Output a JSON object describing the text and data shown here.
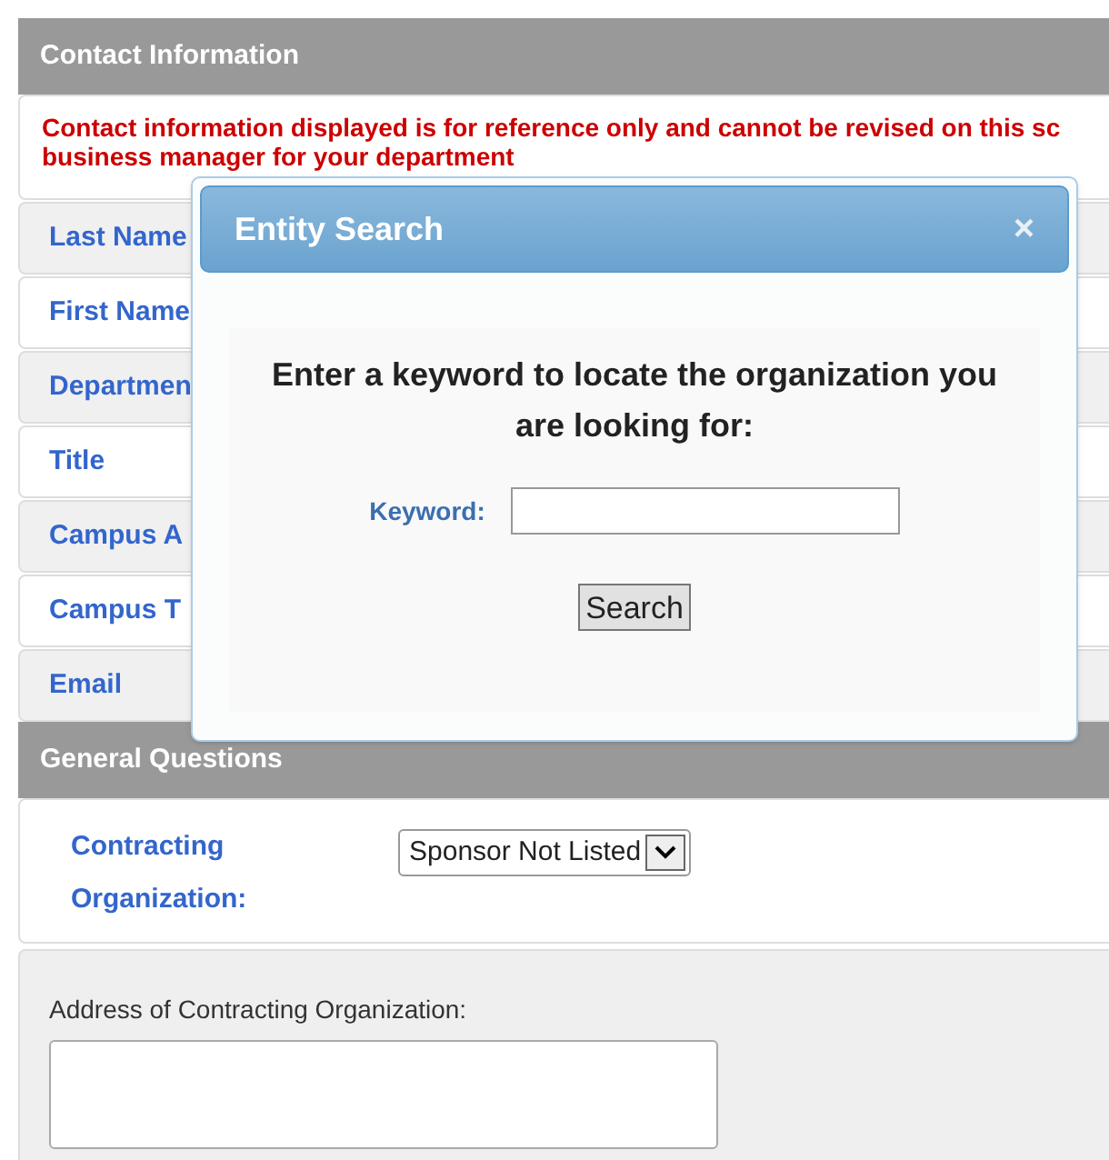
{
  "contact_section": {
    "title": "Contact Information",
    "notice_lines": [
      "Contact information displayed is for reference only and cannot be revised on this sc",
      "business manager for your department"
    ],
    "fields": [
      {
        "label": "Last Name"
      },
      {
        "label": "First Name"
      },
      {
        "label": "Departmen"
      },
      {
        "label": "Title"
      },
      {
        "label": "Campus A"
      },
      {
        "label": "Campus T"
      },
      {
        "label": "Email"
      }
    ]
  },
  "general_section": {
    "title": "General Questions",
    "contracting_label_lines": [
      "Contracting",
      "Organization:"
    ],
    "contracting_value": "Sponsor Not Listed",
    "address_label": "Address of Contracting Organization:"
  },
  "dialog": {
    "title": "Entity Search",
    "close": "×",
    "prompt": "Enter a keyword to locate the organization you are looking for:",
    "keyword_label": "Keyword:",
    "button": "Search"
  }
}
